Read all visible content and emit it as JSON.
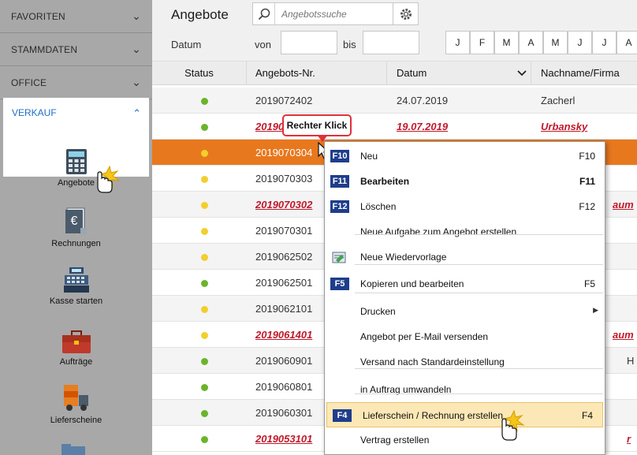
{
  "sidebar": {
    "sections": [
      {
        "label": "FAVORITEN"
      },
      {
        "label": "STAMMDATEN"
      },
      {
        "label": "OFFICE"
      }
    ],
    "active_section": {
      "label": "VERKAUF"
    },
    "items": [
      {
        "label": "Angebote",
        "icon": "calculator-icon"
      },
      {
        "label": "Rechnungen",
        "icon": "invoice-euro-icon"
      },
      {
        "label": "Kasse starten",
        "icon": "cash-register-icon"
      },
      {
        "label": "Aufträge",
        "icon": "briefcase-icon"
      },
      {
        "label": "Lieferscheine",
        "icon": "delivery-truck-icon"
      }
    ]
  },
  "header": {
    "title": "Angebote",
    "search_placeholder": "Angebotssuche"
  },
  "filter": {
    "datum_label": "Datum",
    "von_label": "von",
    "bis_label": "bis",
    "months": [
      "J",
      "F",
      "M",
      "A",
      "M",
      "J",
      "J",
      "A"
    ]
  },
  "table": {
    "columns": [
      "Status",
      "Angebots-Nr.",
      "Datum",
      "Nachname/Firma"
    ],
    "rows": [
      {
        "status": "green",
        "nr": "2019072402",
        "datum": "24.07.2019",
        "name": "Zacherl",
        "red": false
      },
      {
        "status": "green",
        "nr": "20190",
        "datum": "19.07.2019",
        "name": "Urbansky",
        "red": true
      },
      {
        "status": "yellow",
        "nr": "2019070304",
        "datum": "",
        "name": "",
        "red": false,
        "selected": true
      },
      {
        "status": "yellow",
        "nr": "2019070303",
        "datum": "",
        "name": "",
        "red": false
      },
      {
        "status": "yellow",
        "nr": "2019070302",
        "datum": "",
        "name": "aum",
        "red": true
      },
      {
        "status": "yellow",
        "nr": "2019070301",
        "datum": "",
        "name": "",
        "red": false
      },
      {
        "status": "yellow",
        "nr": "2019062502",
        "datum": "",
        "name": "",
        "red": false
      },
      {
        "status": "green",
        "nr": "2019062501",
        "datum": "",
        "name": "",
        "red": false
      },
      {
        "status": "yellow",
        "nr": "2019062101",
        "datum": "",
        "name": "",
        "red": false
      },
      {
        "status": "yellow",
        "nr": "2019061401",
        "datum": "",
        "name": "aum",
        "red": true
      },
      {
        "status": "green",
        "nr": "2019060901",
        "datum": "",
        "name": "H",
        "red": false
      },
      {
        "status": "green",
        "nr": "2019060801",
        "datum": "",
        "name": "",
        "red": false
      },
      {
        "status": "green",
        "nr": "2019060301",
        "datum": "",
        "name": "",
        "red": false
      },
      {
        "status": "green",
        "nr": "2019053101",
        "datum": "",
        "name": "r",
        "red": true
      }
    ]
  },
  "callout": {
    "text": "Rechter Klick"
  },
  "context_menu": {
    "items": [
      {
        "key": "F10",
        "label": "Neu",
        "shortcut": "F10"
      },
      {
        "key": "F11",
        "label": "Bearbeiten",
        "shortcut": "F11",
        "bold": true
      },
      {
        "key": "F12",
        "label": "Löschen",
        "shortcut": "F12"
      },
      {
        "key": "",
        "label": "Neue Aufgabe zum Angebot erstellen",
        "shortcut": ""
      },
      {
        "key": "",
        "label": "Neue Wiedervorlage",
        "shortcut": "",
        "icon": "reminder-icon"
      },
      {
        "key": "F5",
        "label": "Kopieren und bearbeiten",
        "shortcut": "F5"
      },
      {
        "key": "",
        "label": "Drucken",
        "shortcut": "",
        "submenu": true
      },
      {
        "key": "",
        "label": "Angebot per E-Mail versenden",
        "shortcut": ""
      },
      {
        "key": "",
        "label": "Versand nach Standardeinstellung",
        "shortcut": ""
      },
      {
        "key": "",
        "label": "in Auftrag umwandeln",
        "shortcut": ""
      },
      {
        "key": "F4",
        "label": "Lieferschein / Rechnung erstellen",
        "shortcut": "F4",
        "highlighted": true
      },
      {
        "key": "",
        "label": "Vertrag erstellen",
        "shortcut": ""
      }
    ]
  },
  "colors": {
    "accent": "#1a6fc4",
    "selected_row": "#e8781e",
    "status_green": "#6ab42c",
    "status_yellow": "#f2cf2e",
    "key_badge": "#1f3d8c",
    "red_text": "#c0192b",
    "menu_highlight": "#fce8b6"
  }
}
